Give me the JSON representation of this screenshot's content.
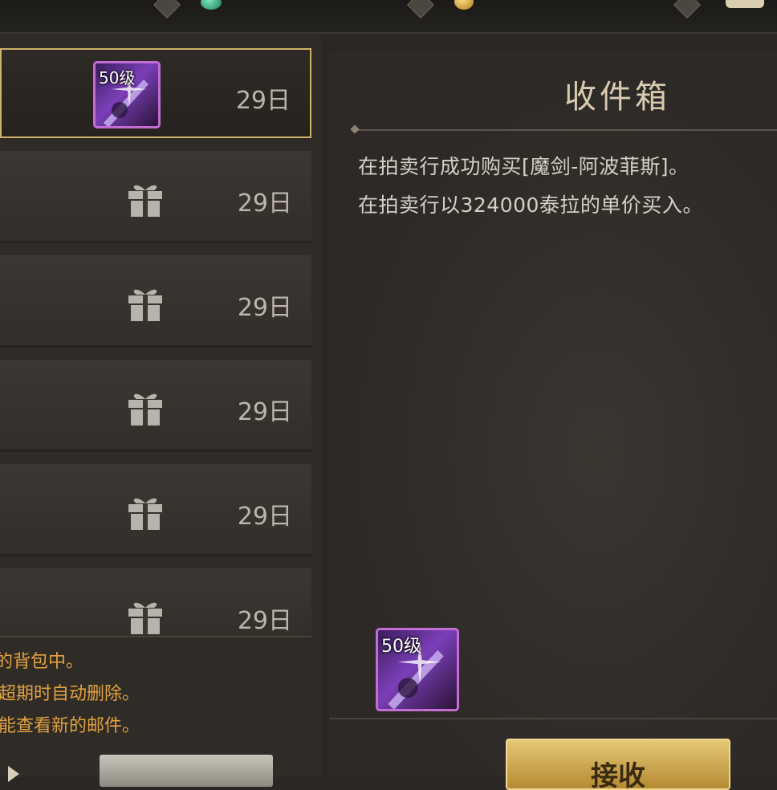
{
  "mailbox": {
    "title": "收件箱",
    "message_lines": [
      "在拍卖行成功购买[魔剑-阿波菲斯]。",
      "在拍卖行以324000泰拉的单价买入。"
    ],
    "attachment_level": "50级",
    "accept_label": "接收"
  },
  "mail_list": [
    {
      "date": "29日",
      "icon": "sword-item-icon",
      "level": "50级",
      "selected": true
    },
    {
      "date": "29日",
      "icon": "gift-icon"
    },
    {
      "date": "29日",
      "icon": "gift-icon"
    },
    {
      "date": "29日",
      "icon": "gift-icon"
    },
    {
      "date": "29日",
      "icon": "gift-icon"
    },
    {
      "date": "29日",
      "icon": "gift-icon"
    }
  ],
  "notes": [
    "的背包中。",
    "超期时自动删除。",
    "能查看新的邮件。"
  ],
  "colors": {
    "accent_gold": "#cdb26a",
    "note_orange": "#e3a240",
    "item_border_purple": "#c66cd6"
  }
}
